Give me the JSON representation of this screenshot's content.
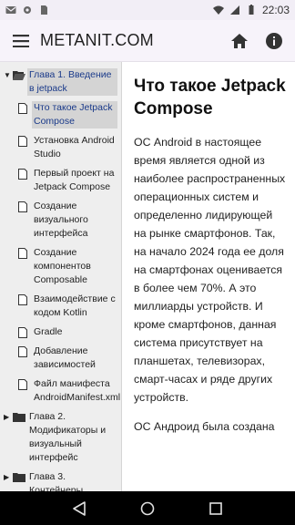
{
  "status_bar": {
    "time": "22:03",
    "icons": [
      "gmail-icon",
      "settings-icon",
      "sim-icon",
      "wifi-icon",
      "signal-icon",
      "battery-icon"
    ]
  },
  "app_bar": {
    "title": "METANIT.COM",
    "icons": [
      "menu-icon",
      "home-icon",
      "info-icon"
    ]
  },
  "sidebar": {
    "chapter1": {
      "label": "Глава 1. Введение в jetpack",
      "expanded": true
    },
    "items": [
      {
        "label": "Что такое Jetpack Compose",
        "selected": true
      },
      {
        "label": "Установка Android Studio"
      },
      {
        "label": "Первый проект на Jetpack Compose"
      },
      {
        "label": "Создание визуального интерфейса"
      },
      {
        "label": "Создание компонентов Composable"
      },
      {
        "label": "Взаимодействие с кодом Kotlin"
      },
      {
        "label": "Gradle"
      },
      {
        "label": "Добавление зависимостей"
      },
      {
        "label": "Файл манифеста AndroidManifest.xml"
      }
    ],
    "chapter2": {
      "label": "Глава 2. Модификаторы и визуальный интерфейс",
      "expanded": false
    },
    "chapter3": {
      "label": "Глава 3. Контейнеры",
      "expanded": false
    }
  },
  "content": {
    "title": "Что такое Jetpack Compose",
    "paragraph1": "ОС Android в настоящее время является одной из наиболее распространенных операционных систем и определенно лидирующей на рынке смартфонов. Так, на начало 2024 года ее доля на смартфонах оценивается в более чем 70%. А это миллиарды устройств. И кроме смартфонов, данная система присутствует на планшетах, телевизорах, смарт-часах и ряде других устройств.",
    "paragraph2": "ОС Андроид была создана"
  },
  "colors": {
    "appbar_bg": "#f7f3fa",
    "sidebar_bg": "#eeeeee",
    "selected_bg": "#d4d4d4",
    "selected_text": "#1a3a8a"
  }
}
